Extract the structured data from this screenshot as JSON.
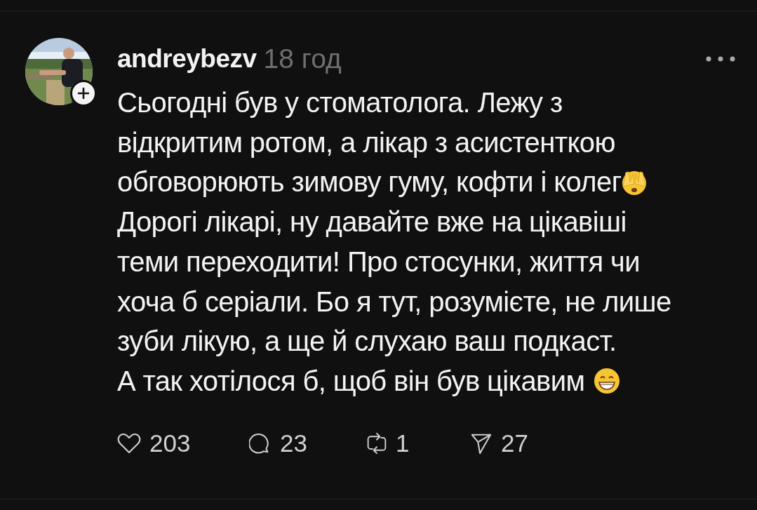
{
  "post": {
    "author": "andreybezv",
    "time": "18 год",
    "lines": [
      {
        "text": "Сьогодні був у стоматолога. Лежу з"
      },
      {
        "text": "відкритим ротом, а лікар з асистенткою"
      },
      {
        "text": "обговорюють зимову гуму, кофти і колег",
        "kind": "peek"
      },
      {
        "text": "Дорогі лікарі, ну давайте вже на цікавіші"
      },
      {
        "text": "теми переходити! Про стосунки, життя чи"
      },
      {
        "text": "хоча б серіали. Бо я тут, розумієте, не лише"
      },
      {
        "text": "зуби лікую, а ще й слухаю ваш подкаст."
      },
      {
        "text": "А так хотілося б, щоб він був цікавим",
        "kind": "grin"
      }
    ],
    "actions": [
      {
        "kind": "like",
        "count": "203"
      },
      {
        "kind": "reply",
        "count": "23"
      },
      {
        "kind": "repost",
        "count": "1"
      },
      {
        "kind": "share",
        "count": "27"
      }
    ]
  }
}
